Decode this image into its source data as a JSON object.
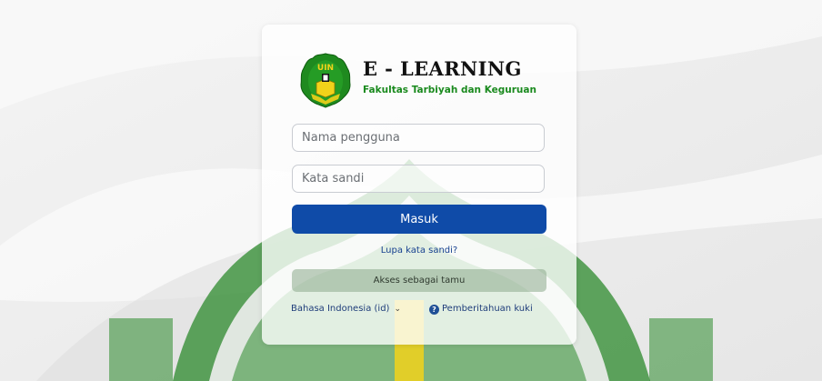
{
  "brand": {
    "title": "E - LEARNING",
    "subtitle": "Fakultas Tarbiyah dan Keguruan",
    "emblem_text": "UIN"
  },
  "login": {
    "username_placeholder": "Nama pengguna",
    "password_placeholder": "Kata sandi",
    "submit_label": "Masuk",
    "forgot_label": "Lupa kata sandi?",
    "guest_label": "Akses sebagai tamu"
  },
  "footer": {
    "language_label": "Bahasa Indonesia (id)",
    "language_chevron": "⌄",
    "cookie_label": "Pemberitahuan kuki",
    "cookie_icon": "question-circle-icon"
  },
  "colors": {
    "primary_button": "#0f4ba8",
    "brand_green": "#1a8a1e",
    "emblem_yellow": "#f2d21a",
    "background_dome": "#2c8a2c"
  }
}
